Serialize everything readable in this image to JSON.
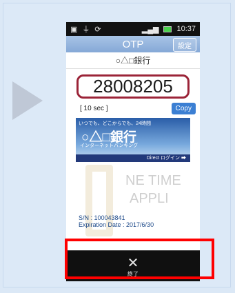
{
  "status_bar": {
    "time": "10:37"
  },
  "app": {
    "title": "OTP",
    "settings_label": "設定",
    "bank_name": "○△□銀行"
  },
  "otp": {
    "code": "28008205",
    "timer": "[ 10 sec ]",
    "copy_label": "Copy"
  },
  "banner": {
    "tagline": "いつでも、どこからでも、24時間",
    "bank": "○△□銀行",
    "service": "インターネットバンキング",
    "link": "Direct ログイン ➡"
  },
  "logo": {
    "line1": "NE TIME",
    "line2": "APPLI"
  },
  "info": {
    "serial": "S/N : 100043841",
    "expiry": "Expiration Date : 2017/6/30"
  },
  "bottom": {
    "exit_label": "終了"
  },
  "colors": {
    "accent_red": "#ff0000",
    "code_border": "#9b2438",
    "copy_blue": "#3b7fd3"
  }
}
